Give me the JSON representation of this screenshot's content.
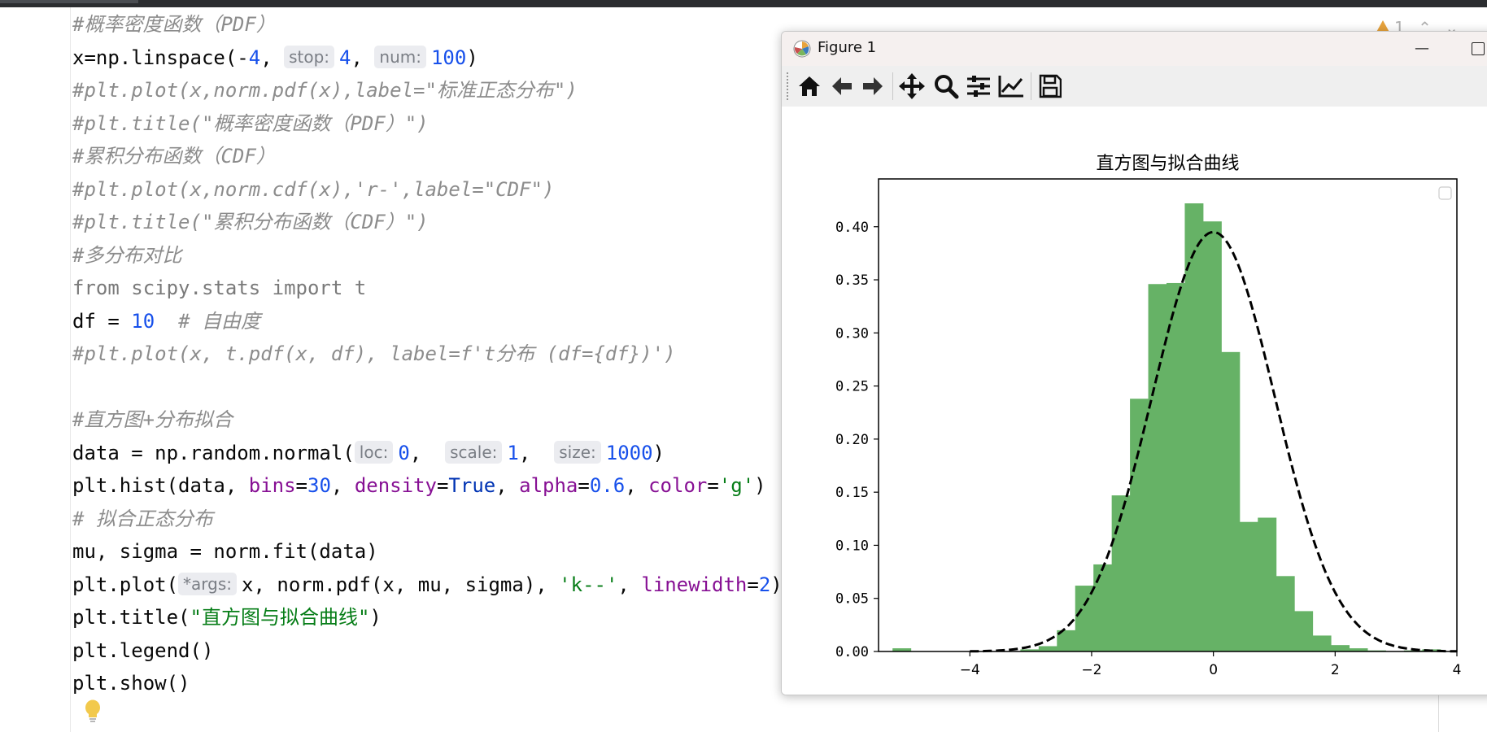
{
  "editor": {
    "lines": [
      [
        {
          "t": "#概率密度函数（PDF）",
          "c": "cm"
        }
      ],
      [
        {
          "t": "x=np.linspace(-",
          "c": "plain"
        },
        {
          "t": "4",
          "c": "num"
        },
        {
          "t": ", ",
          "c": "plain"
        },
        {
          "t": "stop:",
          "c": "hint"
        },
        {
          "t": "4",
          "c": "num"
        },
        {
          "t": ", ",
          "c": "plain"
        },
        {
          "t": "num:",
          "c": "hint"
        },
        {
          "t": "100",
          "c": "num"
        },
        {
          "t": ")",
          "c": "plain"
        }
      ],
      [
        {
          "t": "#plt.plot(x,norm.pdf(x),label=\"标准正态分布\")",
          "c": "cm"
        }
      ],
      [
        {
          "t": "#plt.title(\"概率密度函数（PDF）\")",
          "c": "cm"
        }
      ],
      [
        {
          "t": "#累积分布函数（CDF）",
          "c": "cm"
        }
      ],
      [
        {
          "t": "#plt.plot(x,norm.cdf(x),'r-',label=\"CDF\")",
          "c": "cm"
        }
      ],
      [
        {
          "t": "#plt.title(\"累积分布函数（CDF）\")",
          "c": "cm"
        }
      ],
      [
        {
          "t": "#多分布对比",
          "c": "cm"
        }
      ],
      [
        {
          "t": "from scipy.stats import t",
          "c": "cm-plain"
        }
      ],
      [
        {
          "t": "df = ",
          "c": "plain"
        },
        {
          "t": "10",
          "c": "num"
        },
        {
          "t": "  ",
          "c": "plain"
        },
        {
          "t": "# 自由度",
          "c": "cm"
        }
      ],
      [
        {
          "t": "#plt.plot(x, t.pdf(x, df), label=f't分布 (df={df})')",
          "c": "cm"
        }
      ],
      [],
      [
        {
          "t": "#直方图+分布拟合",
          "c": "cm"
        }
      ],
      [
        {
          "t": "data = np.random.normal(",
          "c": "plain"
        },
        {
          "t": "loc:",
          "c": "hint"
        },
        {
          "t": "0",
          "c": "num"
        },
        {
          "t": ",  ",
          "c": "plain"
        },
        {
          "t": "scale:",
          "c": "hint"
        },
        {
          "t": "1",
          "c": "num"
        },
        {
          "t": ",  ",
          "c": "plain"
        },
        {
          "t": "size:",
          "c": "hint"
        },
        {
          "t": "1000",
          "c": "num"
        },
        {
          "t": ")",
          "c": "plain"
        }
      ],
      [
        {
          "t": "plt.hist(data, ",
          "c": "plain"
        },
        {
          "t": "bins",
          "c": "kwarg"
        },
        {
          "t": "=",
          "c": "plain"
        },
        {
          "t": "30",
          "c": "num"
        },
        {
          "t": ", ",
          "c": "plain"
        },
        {
          "t": "density",
          "c": "kwarg"
        },
        {
          "t": "=",
          "c": "plain"
        },
        {
          "t": "True",
          "c": "kw"
        },
        {
          "t": ", ",
          "c": "plain"
        },
        {
          "t": "alpha",
          "c": "kwarg"
        },
        {
          "t": "=",
          "c": "plain"
        },
        {
          "t": "0.6",
          "c": "num"
        },
        {
          "t": ", ",
          "c": "plain"
        },
        {
          "t": "color",
          "c": "kwarg"
        },
        {
          "t": "=",
          "c": "plain"
        },
        {
          "t": "'g'",
          "c": "str"
        },
        {
          "t": ")",
          "c": "plain"
        }
      ],
      [
        {
          "t": "# 拟合正态分布",
          "c": "cm"
        }
      ],
      [
        {
          "t": "mu, sigma = norm.fit(data)",
          "c": "plain"
        }
      ],
      [
        {
          "t": "plt.plot(",
          "c": "plain"
        },
        {
          "t": "*args:",
          "c": "hint"
        },
        {
          "t": "x, norm.pdf(x, mu, sigma), ",
          "c": "plain"
        },
        {
          "t": "'k--'",
          "c": "str"
        },
        {
          "t": ", ",
          "c": "plain"
        },
        {
          "t": "linewidth",
          "c": "kwarg"
        },
        {
          "t": "=",
          "c": "plain"
        },
        {
          "t": "2",
          "c": "num"
        },
        {
          "t": ")",
          "c": "plain"
        }
      ],
      [
        {
          "t": "plt.title(",
          "c": "plain"
        },
        {
          "t": "\"直方图与拟合曲线\"",
          "c": "str"
        },
        {
          "t": ")",
          "c": "plain"
        }
      ],
      [
        {
          "t": "plt.legend()",
          "c": "plain"
        }
      ],
      [
        {
          "t": "plt.show()",
          "c": "plain"
        }
      ]
    ],
    "warning_count": "1"
  },
  "figure_window": {
    "title": "Figure 1",
    "toolbar": [
      {
        "name": "home-icon"
      },
      {
        "name": "back-icon"
      },
      {
        "name": "forward-icon"
      },
      {
        "name": "pan-icon"
      },
      {
        "name": "zoom-icon"
      },
      {
        "name": "configure-subplots-icon"
      },
      {
        "name": "edit-axis-icon"
      },
      {
        "name": "save-icon"
      }
    ]
  },
  "chart_data": {
    "type": "bar",
    "title": "直方图与拟合曲线",
    "xlabel": "",
    "ylabel": "",
    "xlim": [
      -5.5,
      4.0
    ],
    "ylim": [
      0,
      0.445
    ],
    "xticks": [
      "−4",
      "−2",
      "0",
      "2",
      "4"
    ],
    "xtick_values": [
      -4,
      -2,
      0,
      2,
      4
    ],
    "yticks": [
      "0.00",
      "0.05",
      "0.10",
      "0.15",
      "0.20",
      "0.25",
      "0.30",
      "0.35",
      "0.40"
    ],
    "ytick_values": [
      0,
      0.05,
      0.1,
      0.15,
      0.2,
      0.25,
      0.3,
      0.35,
      0.4
    ],
    "histogram": {
      "color": "#66b266",
      "bin_edges": [
        -5.27,
        -4.97,
        -4.67,
        -4.37,
        -4.07,
        -3.77,
        -3.47,
        -3.17,
        -2.87,
        -2.57,
        -2.27,
        -1.97,
        -1.67,
        -1.37,
        -1.07,
        -0.77,
        -0.47,
        -0.17,
        0.13,
        0.43,
        0.73,
        1.03,
        1.33,
        1.63,
        1.93,
        2.23,
        2.53,
        2.83,
        3.13,
        3.43,
        3.73
      ],
      "density": [
        0.003,
        0,
        0,
        0,
        0,
        0,
        0,
        0.002,
        0.005,
        0.02,
        0.062,
        0.082,
        0.147,
        0.238,
        0.346,
        0.347,
        0.422,
        0.405,
        0.282,
        0.122,
        0.126,
        0.071,
        0.038,
        0.015,
        0.006,
        0.003,
        0.001,
        0,
        0.001,
        0.002
      ]
    },
    "fit_curve": {
      "style": "k--",
      "linewidth": 2,
      "mu": 0.0,
      "sigma": 1.01,
      "x_range": [
        -4,
        4
      ]
    },
    "legend": "top-right (empty)"
  }
}
